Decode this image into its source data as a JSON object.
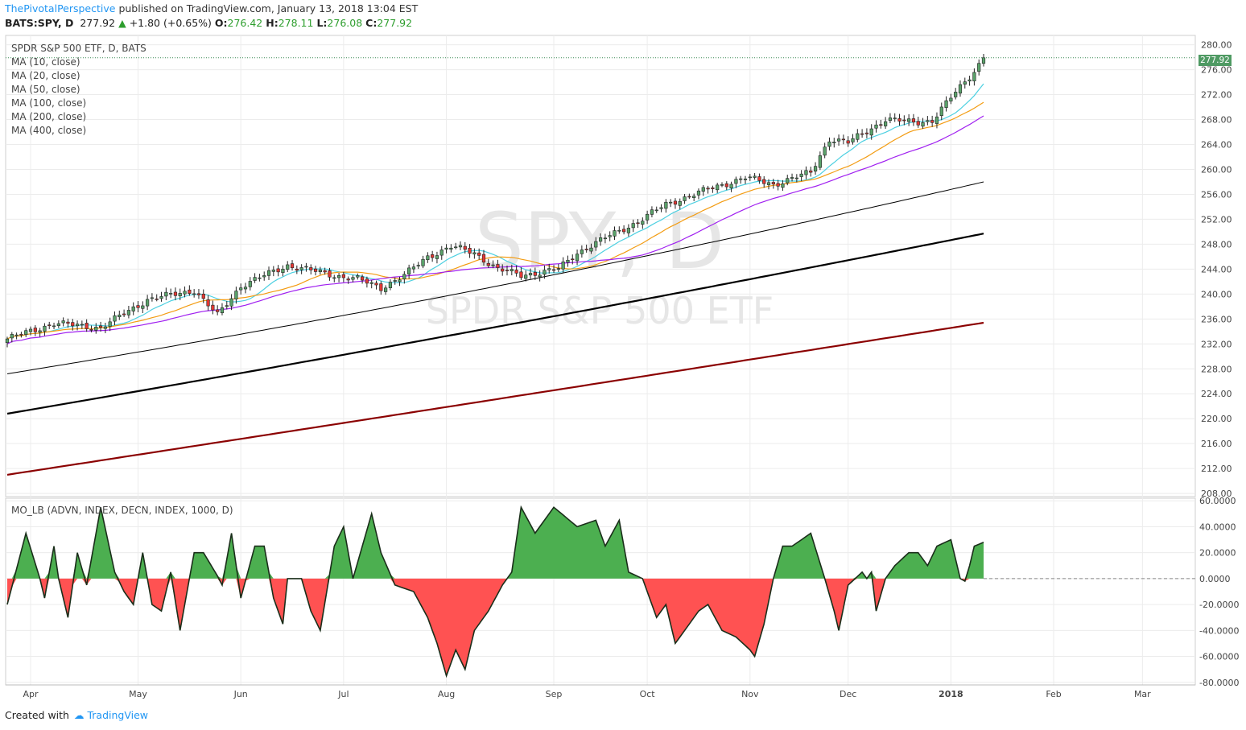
{
  "header": {
    "author": "ThePivotalPerspective",
    "published_text": "published on TradingView.com, January 13, 2018 13:04 EST",
    "symbol": "BATS:SPY, D",
    "last": "277.92",
    "change": "+1.80 (+0.65%)",
    "o_label": "O:",
    "o_value": "276.42",
    "h_label": "H:",
    "h_value": "278.11",
    "l_label": "L:",
    "l_value": "276.08",
    "c_label": "C:",
    "c_value": "277.92"
  },
  "legend": {
    "title": "SPDR S&P 500 ETF, D, BATS",
    "ma": [
      "MA (10, close)",
      "MA (20, close)",
      "MA (50, close)",
      "MA (100, close)",
      "MA (200, close)",
      "MA (400, close)"
    ],
    "indicator": "MO_LB (ADVN, INDEX, DECN, INDEX, 1000, D)"
  },
  "watermark": {
    "symbol": "SPY, D",
    "name": "SPDR S&P 500 ETF"
  },
  "footer": {
    "created": "Created with",
    "brand": "TradingView"
  },
  "colors": {
    "up": "#5ba36b",
    "down": "#e53935",
    "ma10": "#4dd0e1",
    "ma20": "#f39c12",
    "ma50": "#a020f0",
    "ma100": "#000000",
    "ma200": "#000000",
    "ma400": "#8b0000",
    "osc_pos": "#4caf50",
    "osc_neg": "#ff5252",
    "badge": "#4f9a63"
  },
  "chart_data": {
    "type": "candlestick",
    "price_axis": {
      "ticks": [
        "280.00",
        "276.00",
        "272.00",
        "268.00",
        "264.00",
        "260.00",
        "256.00",
        "252.00",
        "248.00",
        "244.00",
        "240.00",
        "236.00",
        "232.00",
        "228.00",
        "224.00",
        "220.00",
        "216.00",
        "212.00",
        "208.00"
      ],
      "range": [
        207.5,
        281.5
      ]
    },
    "osc_axis": {
      "ticks": [
        "60.0000",
        "40.0000",
        "20.0000",
        "0.0000",
        "-20.0000",
        "-40.0000",
        "-60.0000",
        "-80.0000"
      ],
      "range": [
        -82,
        62
      ]
    },
    "x_ticks": [
      "Apr",
      "May",
      "Jun",
      "Jul",
      "Aug",
      "Sep",
      "Oct",
      "Nov",
      "Dec",
      "2018",
      "Feb",
      "Mar"
    ],
    "last_price": "277.92",
    "price_anchors": [
      [
        0,
        232.8
      ],
      [
        10,
        235.3
      ],
      [
        20,
        234.6
      ],
      [
        30,
        239.1
      ],
      [
        40,
        240.6
      ],
      [
        45,
        236.6
      ],
      [
        50,
        241.3
      ],
      [
        60,
        244.6
      ],
      [
        70,
        243.0
      ],
      [
        75,
        242.4
      ],
      [
        80,
        241.0
      ],
      [
        85,
        243.0
      ],
      [
        90,
        246.0
      ],
      [
        95,
        247.6
      ],
      [
        100,
        246.6
      ],
      [
        105,
        244.0
      ],
      [
        110,
        243.0
      ],
      [
        118,
        244.0
      ],
      [
        122,
        246.6
      ],
      [
        128,
        249.0
      ],
      [
        135,
        251.6
      ],
      [
        141,
        254.4
      ],
      [
        150,
        256.8
      ],
      [
        158,
        258.7
      ],
      [
        164,
        257.6
      ],
      [
        172,
        259.5
      ],
      [
        176,
        264.9
      ],
      [
        180,
        264.3
      ],
      [
        188,
        268.0
      ],
      [
        194,
        267.6
      ],
      [
        198,
        267.8
      ],
      [
        203,
        272.4
      ],
      [
        207,
        275.8
      ],
      [
        209,
        277.92
      ]
    ],
    "osc_anchors": [
      [
        0,
        -20
      ],
      [
        4,
        35
      ],
      [
        7,
        0
      ],
      [
        8,
        -15
      ],
      [
        10,
        25
      ],
      [
        11,
        0
      ],
      [
        13,
        -30
      ],
      [
        15,
        20
      ],
      [
        17,
        -5
      ],
      [
        20,
        55
      ],
      [
        23,
        5
      ],
      [
        25,
        -10
      ],
      [
        27,
        -20
      ],
      [
        29,
        20
      ],
      [
        31,
        -20
      ],
      [
        33,
        -25
      ],
      [
        35,
        5
      ],
      [
        37,
        -40
      ],
      [
        40,
        20
      ],
      [
        42,
        20
      ],
      [
        45,
        2
      ],
      [
        46,
        -5
      ],
      [
        48,
        35
      ],
      [
        50,
        -15
      ],
      [
        53,
        25
      ],
      [
        55,
        25
      ],
      [
        57,
        -15
      ],
      [
        59,
        -35
      ],
      [
        60,
        0
      ],
      [
        63,
        0
      ],
      [
        65,
        -25
      ],
      [
        67,
        -40
      ],
      [
        70,
        25
      ],
      [
        72,
        40
      ],
      [
        74,
        0
      ],
      [
        78,
        50
      ],
      [
        80,
        20
      ],
      [
        83,
        -5
      ],
      [
        87,
        -10
      ],
      [
        90,
        -30
      ],
      [
        92,
        -50
      ],
      [
        94,
        -75
      ],
      [
        96,
        -55
      ],
      [
        98,
        -70
      ],
      [
        100,
        -40
      ],
      [
        103,
        -25
      ],
      [
        106,
        -5
      ],
      [
        108,
        5
      ],
      [
        110,
        55
      ],
      [
        113,
        35
      ],
      [
        117,
        55
      ],
      [
        122,
        40
      ],
      [
        126,
        45
      ],
      [
        128,
        25
      ],
      [
        131,
        45
      ],
      [
        133,
        5
      ],
      [
        136,
        0
      ],
      [
        139,
        -30
      ],
      [
        141,
        -20
      ],
      [
        143,
        -50
      ],
      [
        145,
        -40
      ],
      [
        148,
        -25
      ],
      [
        150,
        -20
      ],
      [
        153,
        -40
      ],
      [
        156,
        -45
      ],
      [
        159,
        -55
      ],
      [
        160,
        -60
      ],
      [
        162,
        -35
      ],
      [
        164,
        0
      ],
      [
        166,
        25
      ],
      [
        168,
        25
      ],
      [
        170,
        30
      ],
      [
        172,
        35
      ],
      [
        175,
        0
      ],
      [
        177,
        -25
      ],
      [
        178,
        -40
      ],
      [
        180,
        -5
      ],
      [
        183,
        5
      ],
      [
        184,
        0
      ],
      [
        185,
        5
      ],
      [
        186,
        -25
      ],
      [
        188,
        0
      ],
      [
        190,
        10
      ],
      [
        193,
        20
      ],
      [
        195,
        20
      ],
      [
        197,
        10
      ],
      [
        199,
        25
      ],
      [
        202,
        30
      ],
      [
        204,
        0
      ],
      [
        205,
        -2
      ],
      [
        206,
        10
      ],
      [
        207,
        25
      ],
      [
        209,
        28
      ]
    ]
  }
}
